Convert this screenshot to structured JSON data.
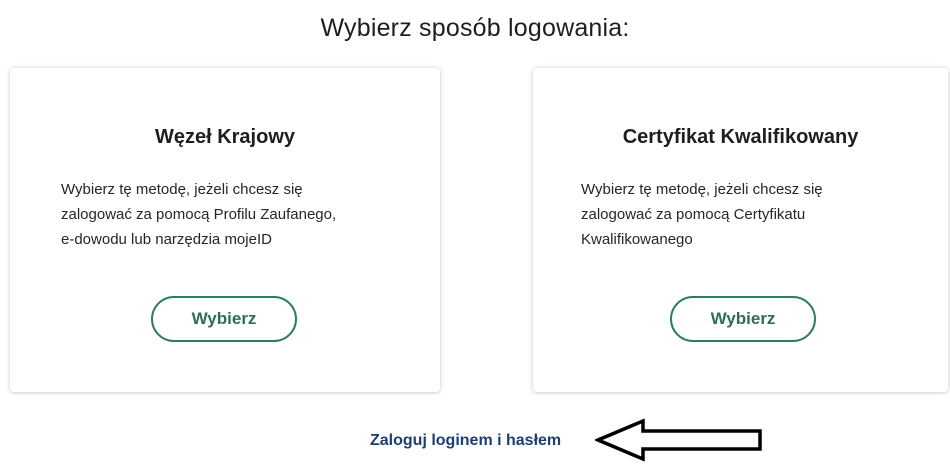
{
  "page": {
    "title": "Wybierz sposób logowania:"
  },
  "options": [
    {
      "title": "Węzeł Krajowy",
      "description": "Wybierz tę metodę, jeżeli chcesz się\nzalogować za pomocą Profilu Zaufanego,\ne-dowodu lub narzędzia mojeID",
      "button_label": "Wybierz"
    },
    {
      "title": "Certyfikat Kwalifikowany",
      "description": "Wybierz tę metodę, jeżeli chcesz się\nzalogować za pomocą Certyfikatu\nKwalifikowanego",
      "button_label": "Wybierz"
    }
  ],
  "footer": {
    "password_login_link": "Zaloguj loginem i hasłem",
    "annotation_icon": "left-arrow-outline-icon"
  },
  "colors": {
    "accent": "#2e7d5b",
    "link": "#1c3f6e"
  }
}
